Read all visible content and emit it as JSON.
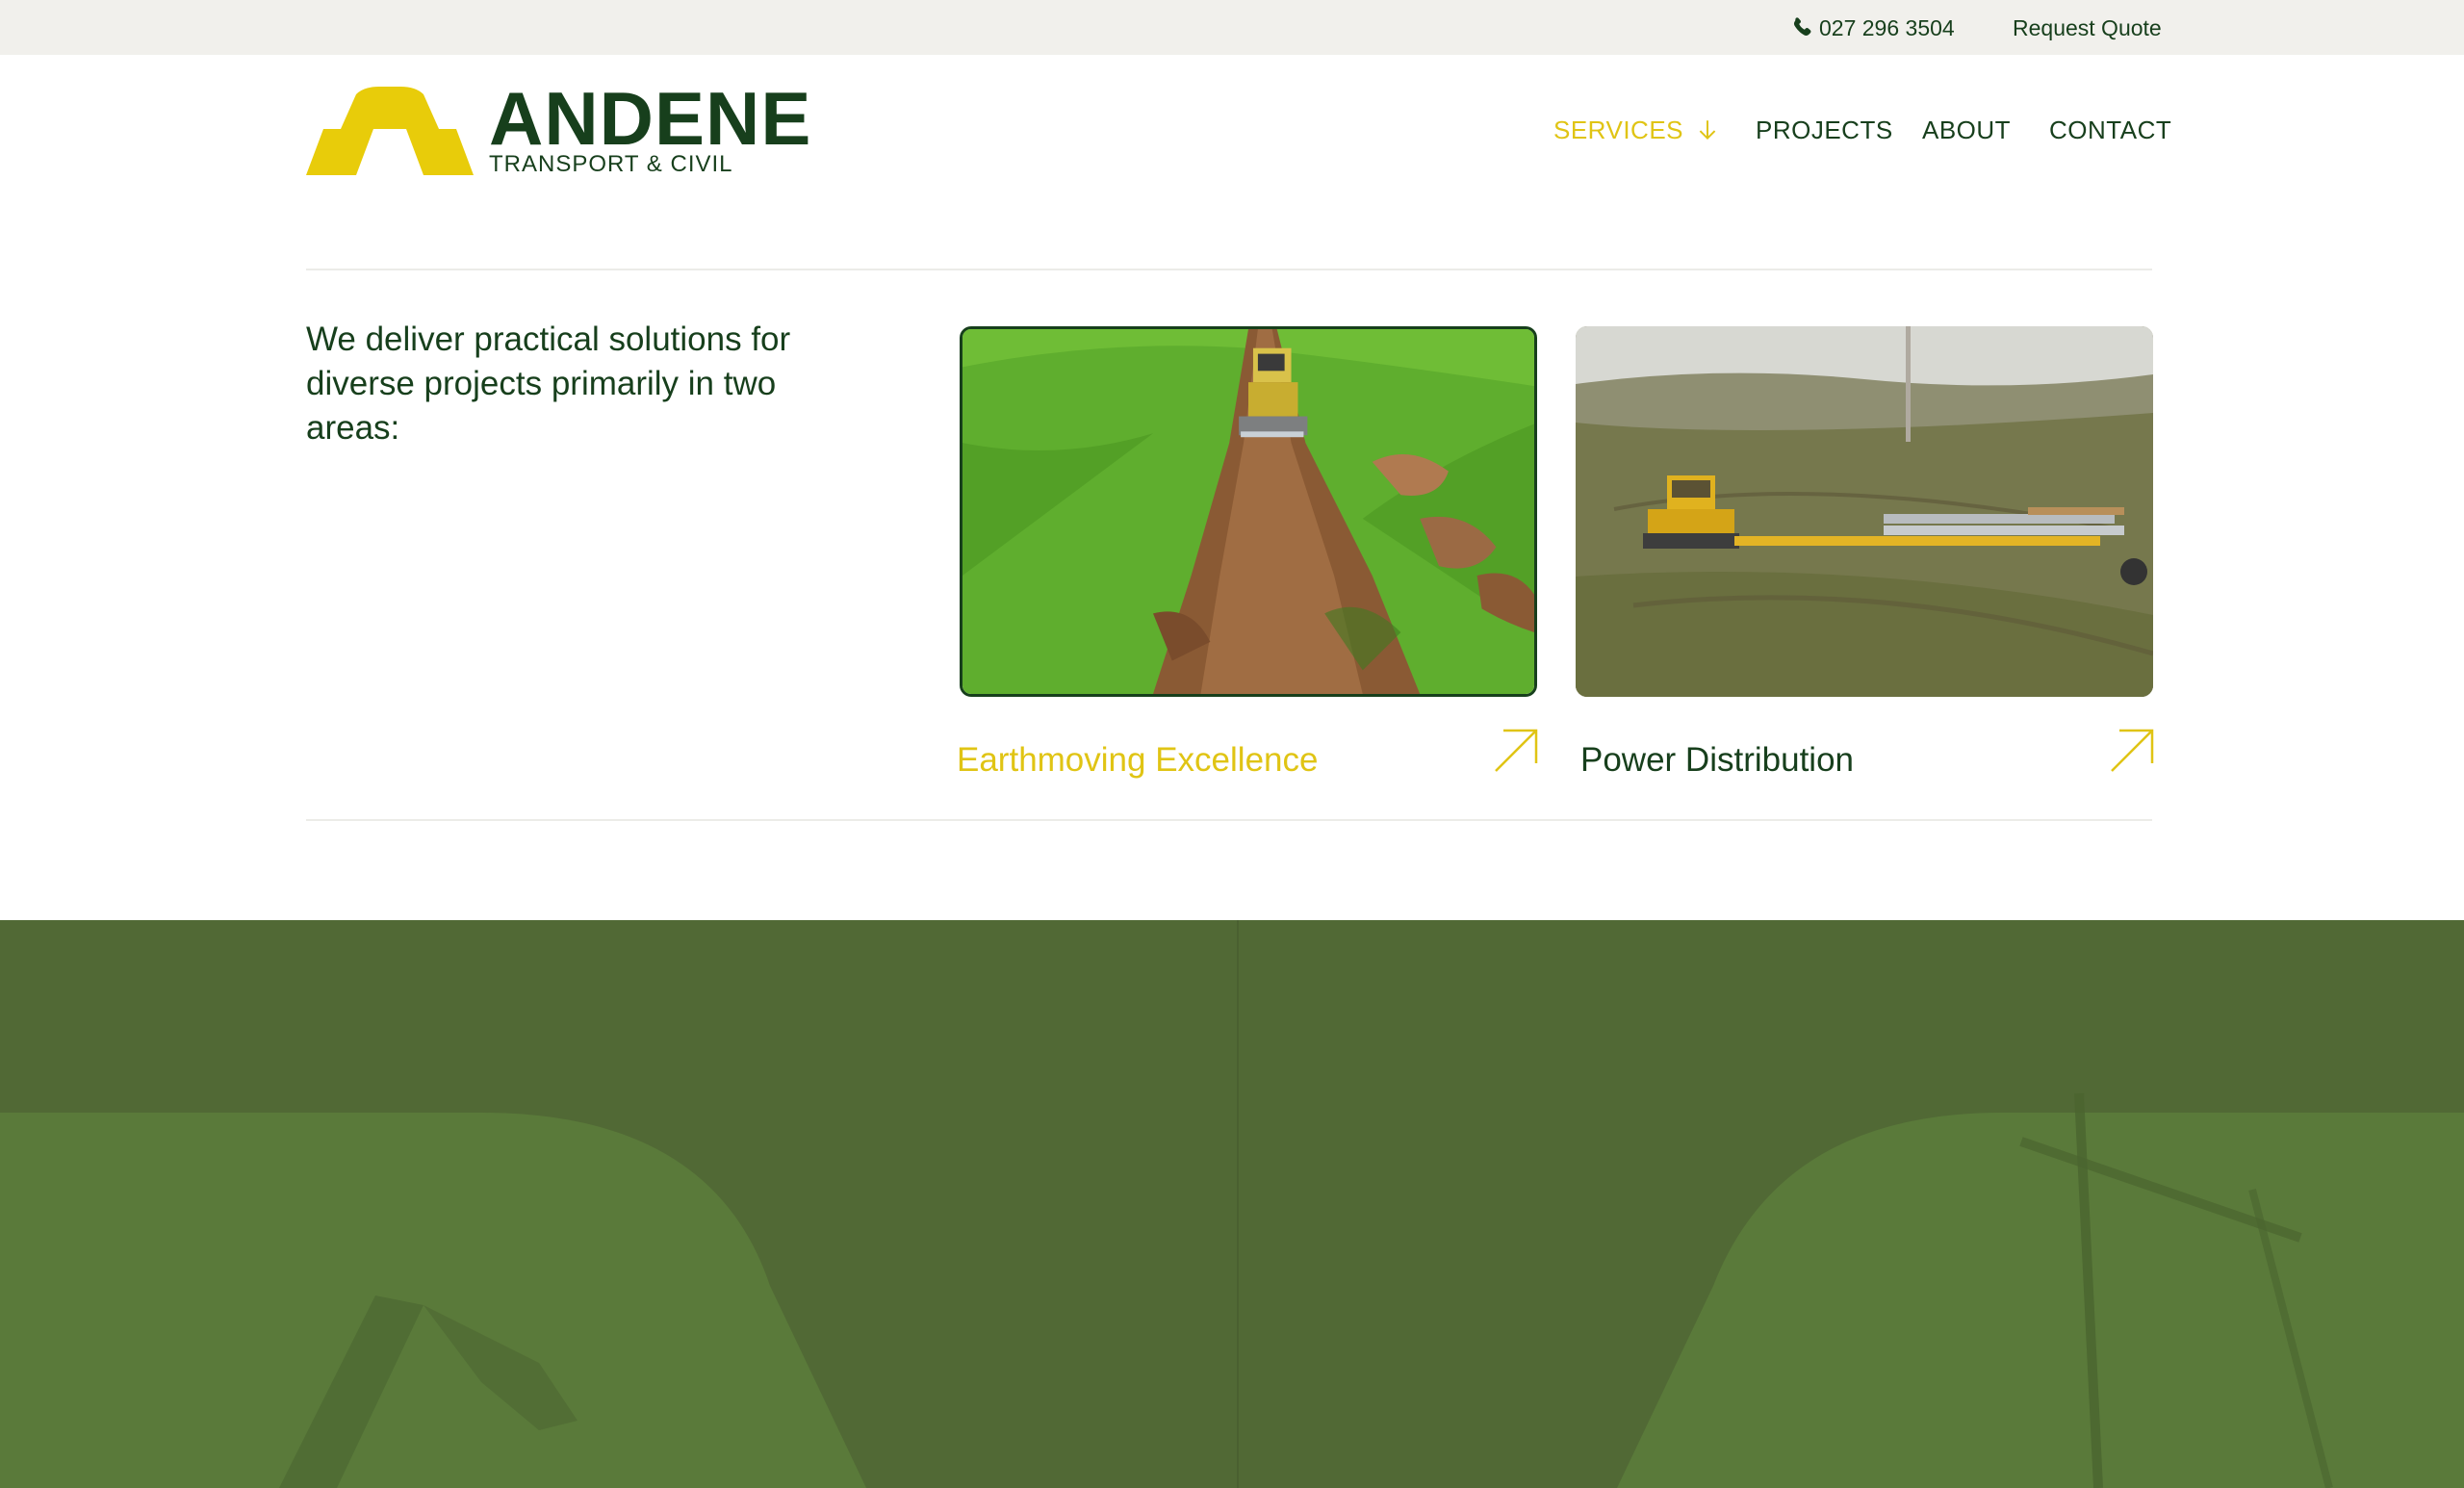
{
  "topbar": {
    "phone_icon": "phone-icon",
    "phone": "027 296 3504",
    "request_quote": "Request Quote"
  },
  "brand": {
    "name": "ANDENE",
    "tagline": "TRANSPORT & CIVIL",
    "colors": {
      "dark_green": "#173f1c",
      "yellow": "#e0c414",
      "section_green": "#516935"
    }
  },
  "nav": {
    "services": "SERVICES",
    "services_icon": "arrow-down-icon",
    "projects": "PROJECTS",
    "about": "ABOUT",
    "contact": "CONTACT"
  },
  "intro": {
    "text": "We deliver practical solutions for diverse projects primarily in two areas:"
  },
  "services": [
    {
      "title": "Earthmoving Excellence",
      "image": "bulldozer-trench-photo",
      "arrow_icon": "arrow-up-right-icon",
      "active": true
    },
    {
      "title": "Power Distribution",
      "image": "pole-transport-photo",
      "arrow_icon": "arrow-up-right-icon",
      "active": false
    }
  ]
}
